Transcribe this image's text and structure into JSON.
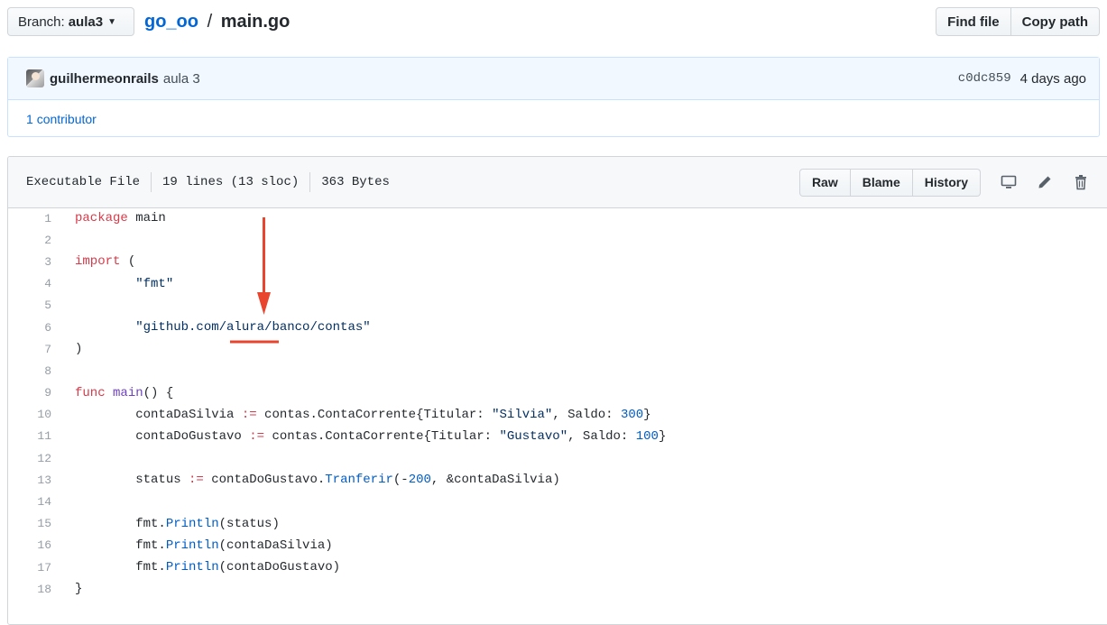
{
  "topbar": {
    "branch_prefix": "Branch:",
    "branch_name": "aula3",
    "repo": "go_oo",
    "separator": "/",
    "file": "main.go",
    "find_file": "Find file",
    "copy_path": "Copy path"
  },
  "commit": {
    "author": "guilhermeonrails",
    "message": "aula 3",
    "sha": "c0dc859",
    "ago": "4 days ago",
    "contributors_count": "1",
    "contributors_label": "contributor"
  },
  "file_header": {
    "type": "Executable File",
    "lines": "19 lines (13 sloc)",
    "size": "363 Bytes",
    "raw": "Raw",
    "blame": "Blame",
    "history": "History"
  },
  "code": {
    "line_numbers": [
      "1",
      "2",
      "3",
      "4",
      "5",
      "6",
      "7",
      "8",
      "9",
      "10",
      "11",
      "12",
      "13",
      "14",
      "15",
      "16",
      "17",
      "18"
    ],
    "lines": [
      [
        {
          "t": "package",
          "c": "kw"
        },
        {
          "t": " main",
          "c": ""
        }
      ],
      [],
      [
        {
          "t": "import",
          "c": "kw"
        },
        {
          "t": " (",
          "c": ""
        }
      ],
      [
        {
          "t": "        ",
          "c": ""
        },
        {
          "t": "\"fmt\"",
          "c": "st"
        }
      ],
      [],
      [
        {
          "t": "        ",
          "c": ""
        },
        {
          "t": "\"github.com/alura/banco/contas\"",
          "c": "st"
        }
      ],
      [
        {
          "t": ")",
          "c": ""
        }
      ],
      [],
      [
        {
          "t": "func",
          "c": "kw"
        },
        {
          "t": " ",
          "c": ""
        },
        {
          "t": "main",
          "c": "fn"
        },
        {
          "t": "() {",
          "c": ""
        }
      ],
      [
        {
          "t": "        contaDaSilvia ",
          "c": ""
        },
        {
          "t": ":=",
          "c": "kw"
        },
        {
          "t": " contas.ContaCorrente{Titular: ",
          "c": ""
        },
        {
          "t": "\"Silvia\"",
          "c": "st"
        },
        {
          "t": ", Saldo: ",
          "c": ""
        },
        {
          "t": "300",
          "c": "nm"
        },
        {
          "t": "}",
          "c": ""
        }
      ],
      [
        {
          "t": "        contaDoGustavo ",
          "c": ""
        },
        {
          "t": ":=",
          "c": "kw"
        },
        {
          "t": " contas.ContaCorrente{Titular: ",
          "c": ""
        },
        {
          "t": "\"Gustavo\"",
          "c": "st"
        },
        {
          "t": ", Saldo: ",
          "c": ""
        },
        {
          "t": "100",
          "c": "nm"
        },
        {
          "t": "}",
          "c": ""
        }
      ],
      [],
      [
        {
          "t": "        status ",
          "c": ""
        },
        {
          "t": ":=",
          "c": "kw"
        },
        {
          "t": " contaDoGustavo.",
          "c": ""
        },
        {
          "t": "Tranferir",
          "c": "mt"
        },
        {
          "t": "(-",
          "c": ""
        },
        {
          "t": "200",
          "c": "nm"
        },
        {
          "t": ", &contaDaSilvia)",
          "c": ""
        }
      ],
      [],
      [
        {
          "t": "        fmt.",
          "c": ""
        },
        {
          "t": "Println",
          "c": "mt"
        },
        {
          "t": "(status)",
          "c": ""
        }
      ],
      [
        {
          "t": "        fmt.",
          "c": ""
        },
        {
          "t": "Println",
          "c": "mt"
        },
        {
          "t": "(contaDaSilvia)",
          "c": ""
        }
      ],
      [
        {
          "t": "        fmt.",
          "c": ""
        },
        {
          "t": "Println",
          "c": "mt"
        },
        {
          "t": "(contaDoGustavo)",
          "c": ""
        }
      ],
      [
        {
          "t": "}",
          "c": ""
        }
      ]
    ]
  },
  "colors": {
    "annotation": "#e8442e",
    "link": "#0366d6"
  }
}
